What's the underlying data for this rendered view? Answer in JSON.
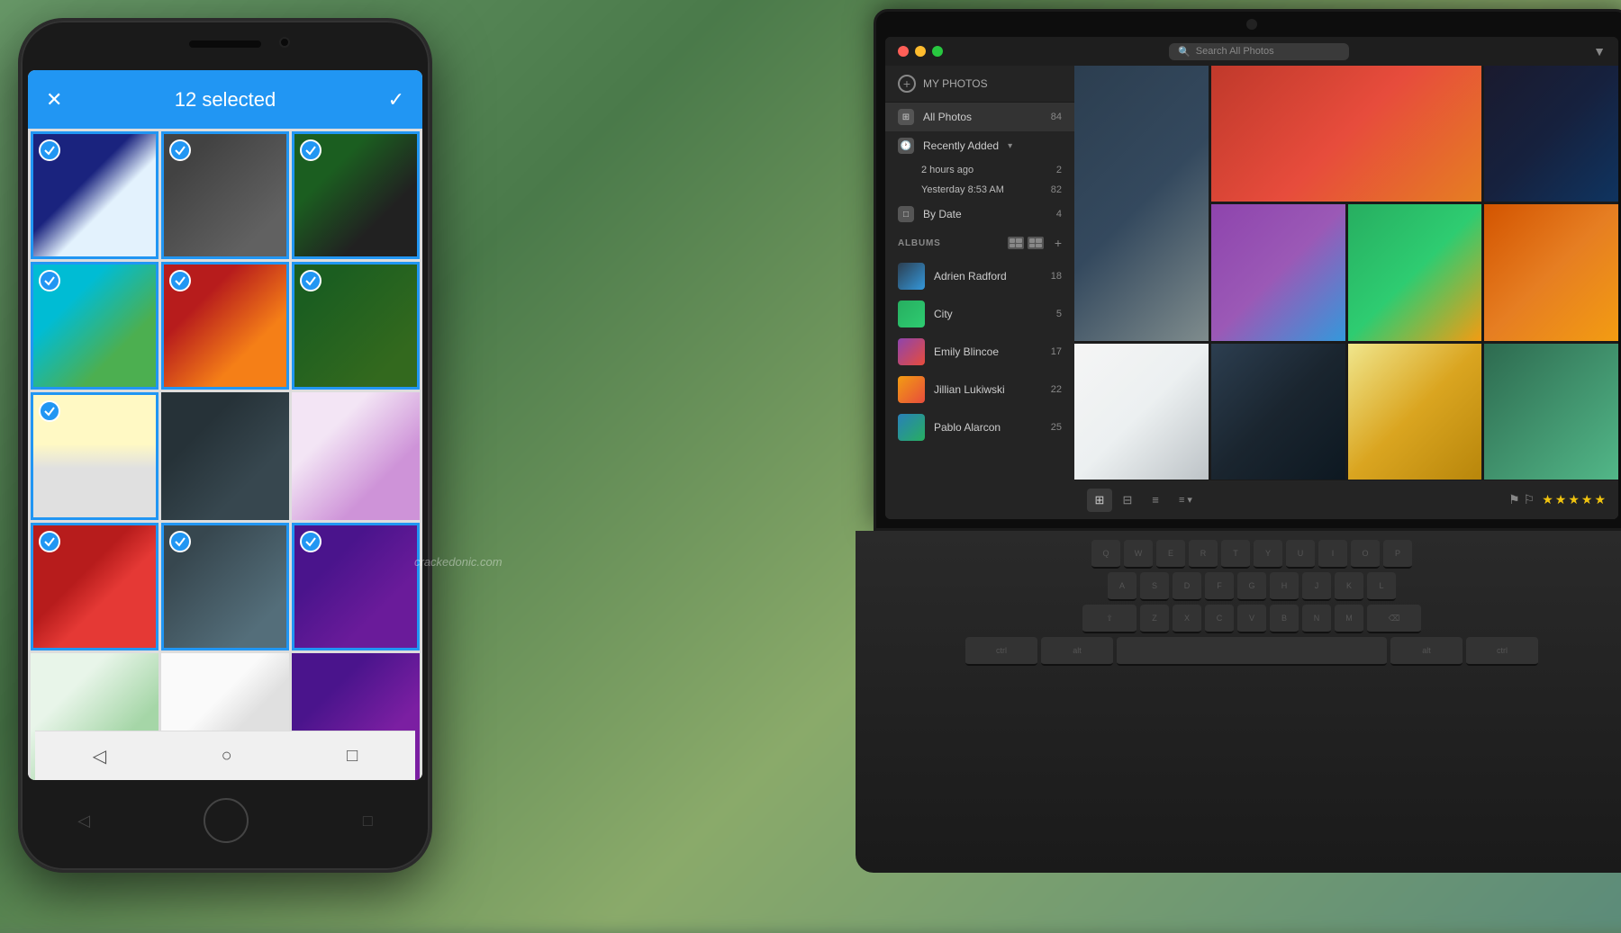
{
  "scene": {
    "watermark": "crackedonic.com"
  },
  "phone": {
    "topbar": {
      "selected_count": "12 selected",
      "close_icon": "✕",
      "check_icon": "✓"
    },
    "grid_photos": [
      {
        "id": 1,
        "selected": true,
        "color": "pp-1"
      },
      {
        "id": 2,
        "selected": true,
        "color": "pp-2"
      },
      {
        "id": 3,
        "selected": true,
        "color": "pp-3"
      },
      {
        "id": 4,
        "selected": true,
        "color": "pp-4"
      },
      {
        "id": 5,
        "selected": true,
        "color": "pp-5"
      },
      {
        "id": 6,
        "selected": true,
        "color": "pp-6"
      },
      {
        "id": 7,
        "selected": true,
        "color": "pp-7"
      },
      {
        "id": 8,
        "selected": false,
        "color": "pp-8"
      },
      {
        "id": 9,
        "selected": false,
        "color": "pp-9"
      },
      {
        "id": 10,
        "selected": true,
        "color": "pp-10"
      },
      {
        "id": 11,
        "selected": true,
        "color": "pp-11"
      },
      {
        "id": 12,
        "selected": true,
        "color": "pp-12"
      },
      {
        "id": 13,
        "selected": false,
        "color": "pp-13"
      },
      {
        "id": 14,
        "selected": false,
        "color": "pp-14"
      },
      {
        "id": 15,
        "selected": false,
        "color": "pp-15"
      }
    ],
    "nav_buttons": [
      "◁",
      "○",
      "□"
    ]
  },
  "laptop": {
    "titlebar": {
      "search_placeholder": "Search All Photos",
      "filter_icon": "▼"
    },
    "sidebar": {
      "my_photos_label": "MY PHOTOS",
      "add_icon": "+",
      "all_photos": {
        "label": "All Photos",
        "count": "84",
        "icon": "⊞"
      },
      "recently_added": {
        "label": "Recently Added",
        "arrow": "▾",
        "sub_items": [
          {
            "label": "2 hours ago",
            "count": "2"
          },
          {
            "label": "Yesterday 8:53 AM",
            "count": "82"
          }
        ]
      },
      "by_date": {
        "label": "By Date",
        "count": "4",
        "icon": "□"
      },
      "albums_label": "ALBUMS",
      "albums": [
        {
          "name": "Adrien Radford",
          "count": "18",
          "color": "album-color-1"
        },
        {
          "name": "City",
          "count": "5",
          "color": "album-color-2"
        },
        {
          "name": "Emily Blincoe",
          "count": "17",
          "color": "album-color-3"
        },
        {
          "name": "Jillian Lukiwski",
          "count": "22",
          "color": "album-color-4"
        },
        {
          "name": "Pablo Alarcon",
          "count": "25",
          "color": "album-color-5"
        }
      ]
    },
    "photos": [
      {
        "id": 1,
        "color": "pc-1",
        "span": "col"
      },
      {
        "id": 2,
        "color": "pc-2"
      },
      {
        "id": 3,
        "color": "pc-3"
      },
      {
        "id": 4,
        "color": "pc-4"
      },
      {
        "id": 5,
        "color": "pc-5"
      },
      {
        "id": 6,
        "color": "pc-6"
      },
      {
        "id": 7,
        "color": "pc-7"
      },
      {
        "id": 8,
        "color": "pc-8"
      },
      {
        "id": 9,
        "color": "pc-9"
      },
      {
        "id": 10,
        "color": "pc-10"
      },
      {
        "id": 11,
        "color": "pc-11"
      },
      {
        "id": 12,
        "color": "pc-12"
      }
    ],
    "bottom_bar": {
      "view_icons": [
        "⊞",
        "⊟",
        "≡"
      ],
      "sort_label": "≡ ▾",
      "flag_icons": [
        "⚑",
        "⚐"
      ],
      "stars": [
        "★",
        "★",
        "★",
        "★",
        "★"
      ]
    },
    "keyboard_rows": [
      [
        "Q",
        "W",
        "E",
        "R",
        "T",
        "Y",
        "U",
        "I",
        "O",
        "P"
      ],
      [
        "A",
        "S",
        "D",
        "F",
        "G",
        "H",
        "J",
        "K",
        "L"
      ],
      [
        "Z",
        "X",
        "C",
        "V",
        "B",
        "N",
        "M"
      ]
    ]
  }
}
